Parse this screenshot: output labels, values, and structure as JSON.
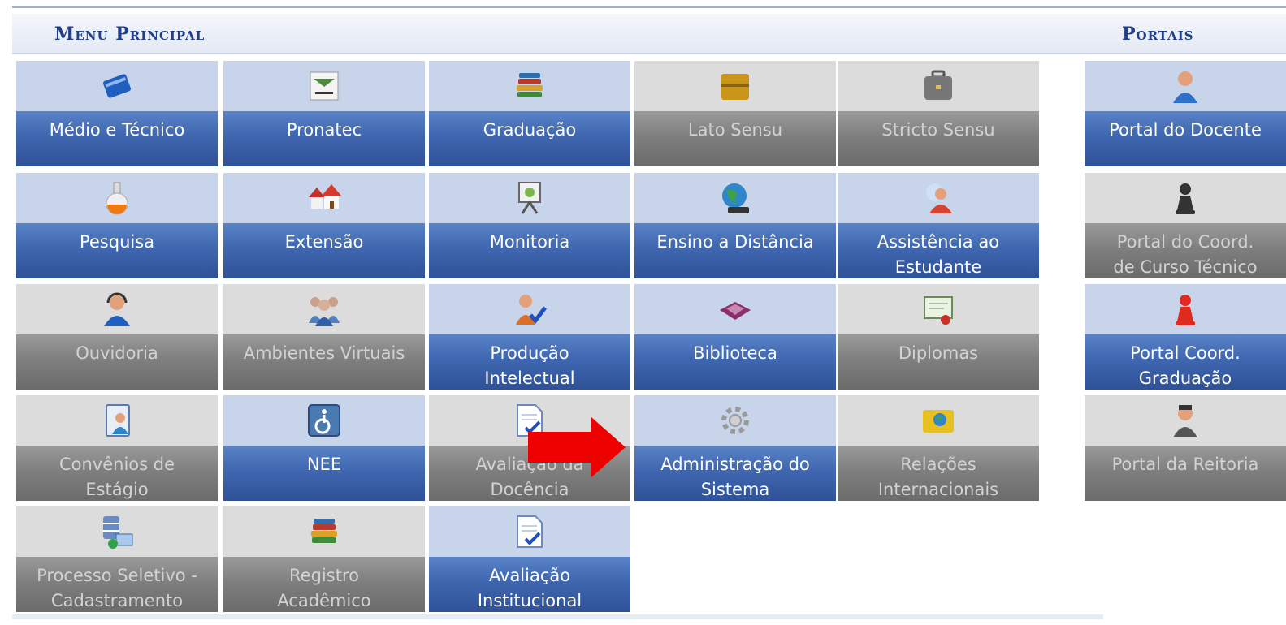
{
  "menu_principal": {
    "title": "Menu Principal",
    "items": [
      {
        "label": "Médio e Técnico",
        "icon": "book-icon",
        "active": true
      },
      {
        "label": "Pronatec",
        "icon": "pronatec-logo-icon",
        "active": true
      },
      {
        "label": "Graduação",
        "icon": "books-stack-icon",
        "active": true
      },
      {
        "label": "Lato Sensu",
        "icon": "folder-icon",
        "active": false
      },
      {
        "label": "Stricto Sensu",
        "icon": "briefcase-icon",
        "active": false
      },
      {
        "label": "Pesquisa",
        "icon": "flask-icon",
        "active": true
      },
      {
        "label": "Extensão",
        "icon": "houses-icon",
        "active": true
      },
      {
        "label": "Monitoria",
        "icon": "presentation-board-icon",
        "active": true
      },
      {
        "label": "Ensino a Distância",
        "icon": "globe-computer-icon",
        "active": true
      },
      {
        "label": "Assistência ao\nEstudante",
        "icon": "student-assistance-icon",
        "active": true
      },
      {
        "label": "Ouvidoria",
        "icon": "headset-user-icon",
        "active": false
      },
      {
        "label": "Ambientes Virtuais",
        "icon": "users-group-icon",
        "active": false
      },
      {
        "label": "Produção\nIntelectual",
        "icon": "user-check-icon",
        "active": true
      },
      {
        "label": "Biblioteca",
        "icon": "open-book-icon",
        "active": true
      },
      {
        "label": "Diplomas",
        "icon": "certificate-icon",
        "active": false
      },
      {
        "label": "Convênios de\nEstágio",
        "icon": "contact-book-icon",
        "active": false
      },
      {
        "label": "NEE",
        "icon": "wheelchair-icon",
        "active": true
      },
      {
        "label": "Avaliação da\nDocência",
        "icon": "document-check-icon",
        "active": false
      },
      {
        "label": "Administração do\nSistema",
        "icon": "gear-icon",
        "active": true
      },
      {
        "label": "Relações\nInternacionais",
        "icon": "globe-folder-icon",
        "active": false
      },
      {
        "label": "Processo Seletivo -\nCadastramento",
        "icon": "database-icon",
        "active": false
      },
      {
        "label": "Registro\nAcadêmico",
        "icon": "books-stack-icon",
        "active": false
      },
      {
        "label": "Avaliação\nInstitucional",
        "icon": "document-check-icon",
        "active": true
      }
    ]
  },
  "portais": {
    "title": "Portais",
    "items": [
      {
        "label": "Portal do Docente",
        "icon": "teacher-icon",
        "active": true
      },
      {
        "label": "Portal do Coord.\nde Curso Técnico",
        "icon": "pawn-black-icon",
        "active": false
      },
      {
        "label": "Portal Coord.\nGraduação",
        "icon": "pawn-red-icon",
        "active": true
      },
      {
        "label": "Portal da Reitoria",
        "icon": "rector-icon",
        "active": false
      }
    ]
  },
  "colors": {
    "active_blue": "#3f67b0",
    "inactive_gray": "#7f7f7f",
    "header_text": "#1f3f8a",
    "arrow_red": "#ee0000"
  },
  "annotation": {
    "arrow": "red-arrow-icon"
  }
}
